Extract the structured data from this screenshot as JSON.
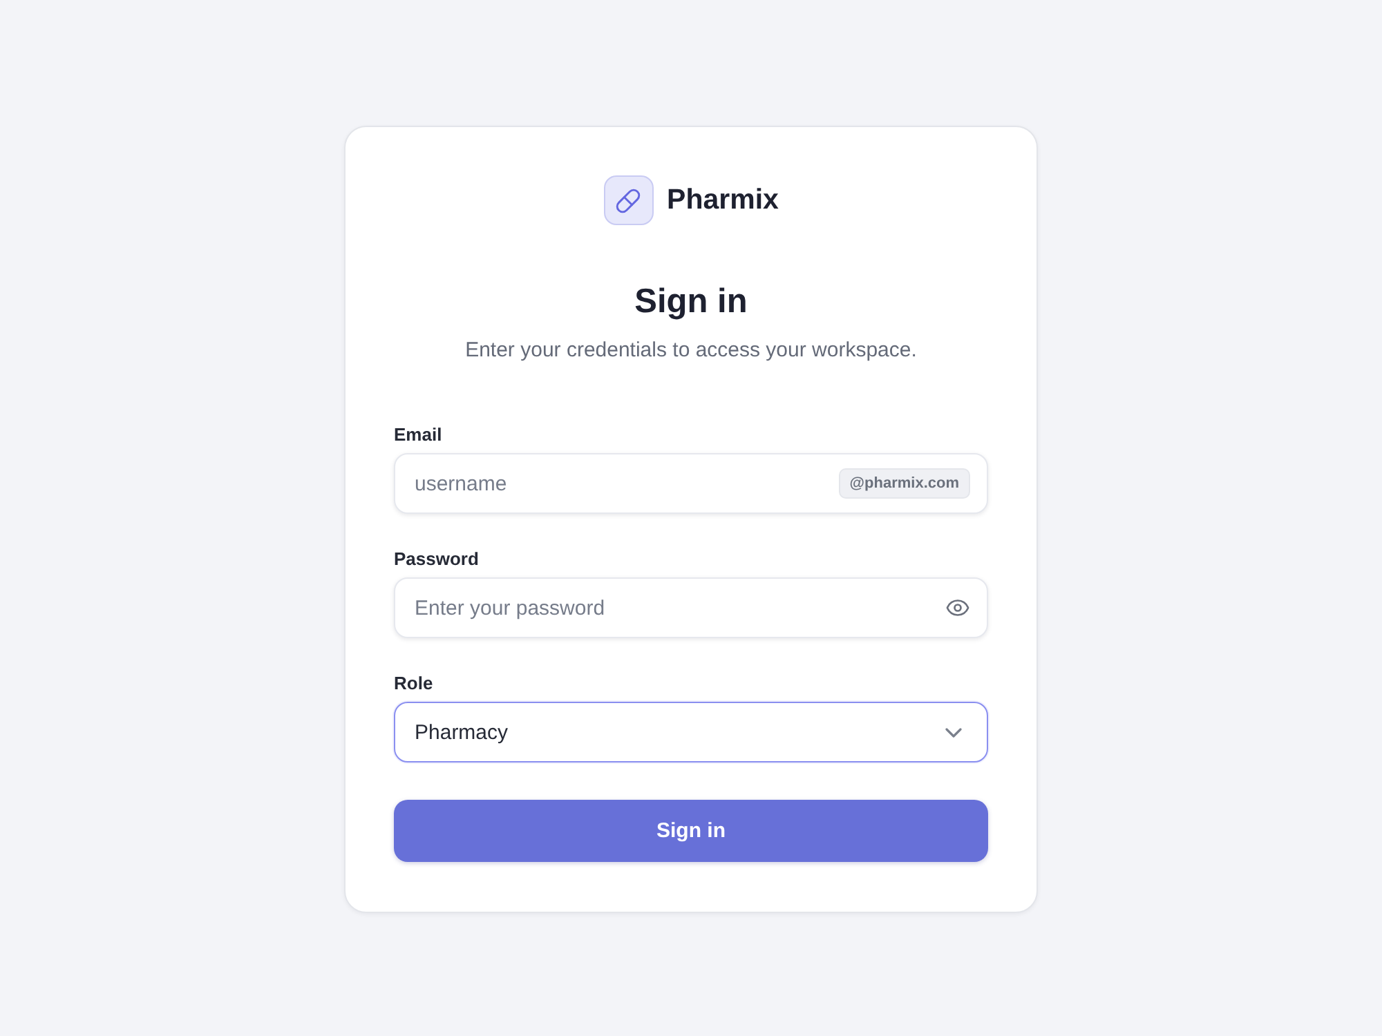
{
  "brand": {
    "name": "Pharmix"
  },
  "heading": {
    "title": "Sign in",
    "subtitle": "Enter your credentials to access your workspace."
  },
  "fields": [
    {
      "kind": "email",
      "label": "Email",
      "placeholder": "username",
      "suffix": "@pharmix.com",
      "focused": false
    },
    {
      "kind": "password",
      "label": "Password",
      "placeholder": "Enter your password",
      "focused": false
    },
    {
      "kind": "select",
      "label": "Role",
      "value": "Pharmacy",
      "focused": true
    }
  ],
  "submit": {
    "label": "Sign in"
  }
}
